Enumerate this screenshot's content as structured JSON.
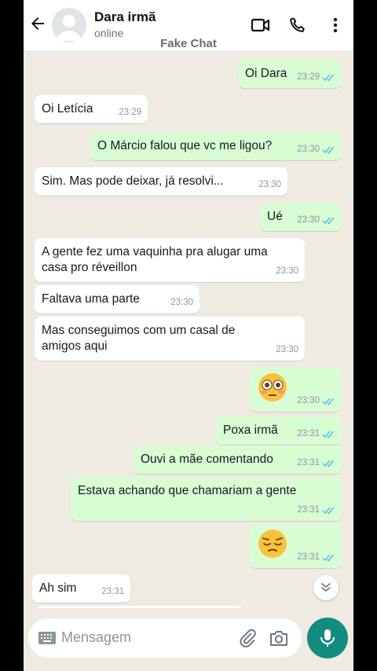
{
  "header": {
    "contact_name": "Dara irmã",
    "status": "online",
    "app_title": "Fake Chat"
  },
  "messages": [
    {
      "side": "out",
      "text": "Oi Dara",
      "time": "23:29"
    },
    {
      "side": "in",
      "text": "Oi Letícia",
      "time": "23:29"
    },
    {
      "side": "out",
      "text": "O Márcio falou que vc me ligou?",
      "time": "23:30"
    },
    {
      "side": "in",
      "text": "Sim. Mas pode deixar, já resolvi...",
      "time": "23:30"
    },
    {
      "side": "out",
      "text": "Ué",
      "time": "23:30"
    },
    {
      "side": "in",
      "text": "A gente fez uma vaquinha pra alugar uma\ncasa pro réveillon",
      "time": "23:30"
    },
    {
      "side": "in",
      "text": "Faltava uma parte",
      "time": "23:30"
    },
    {
      "side": "in",
      "text": "Mas conseguimos com um casal de\namigos aqui",
      "time": "23:30"
    },
    {
      "side": "out",
      "emoji": "flushed-face",
      "time": "23:30"
    },
    {
      "side": "out",
      "text": "Poxa irmã",
      "time": "23:31"
    },
    {
      "side": "out",
      "text": "Ouvi a mãe comentando",
      "time": "23:31"
    },
    {
      "side": "out",
      "text": "Estava achando que chamariam a gente",
      "time": "23:31"
    },
    {
      "side": "out",
      "emoji": "pensive-face",
      "time": "23:31"
    },
    {
      "side": "in",
      "text": "Ah sim",
      "time": "23:31"
    }
  ],
  "input": {
    "placeholder": "Mensagem"
  },
  "colors": {
    "chat_background": "#efeae2",
    "incoming_bubble": "#ffffff",
    "outgoing_bubble": "#d9fdd3",
    "read_ticks": "#53bdeb",
    "mic_button": "#128c7e"
  },
  "icons": [
    "back-arrow-icon",
    "video-call-icon",
    "phone-icon",
    "more-options-icon",
    "keyboard-icon",
    "attach-icon",
    "camera-icon",
    "mic-icon",
    "chevron-down-icon"
  ]
}
